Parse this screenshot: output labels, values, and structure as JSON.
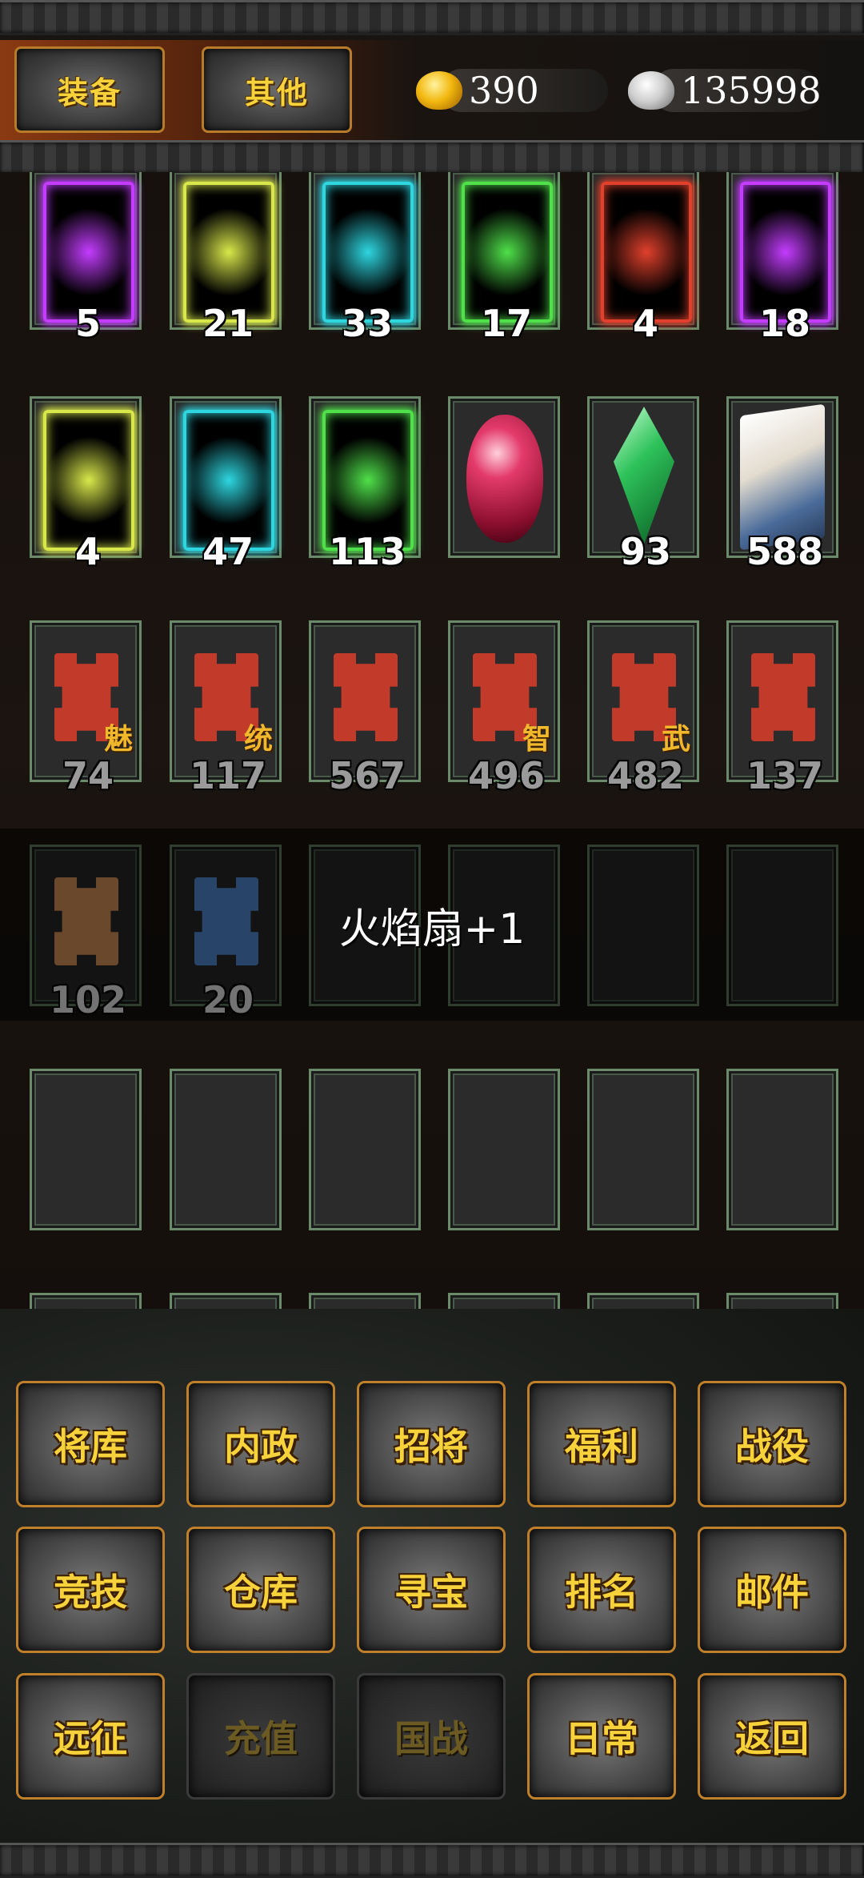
{
  "header": {
    "tabs": [
      {
        "label": "装备"
      },
      {
        "label": "其他"
      }
    ],
    "gold": "390",
    "silver": "135998"
  },
  "inventory": {
    "rows": [
      [
        {
          "count": "5",
          "icon": "horse-card-icon",
          "color": "#c43cff"
        },
        {
          "count": "21",
          "icon": "horse-card-icon",
          "color": "#d8e84a"
        },
        {
          "count": "33",
          "icon": "horse-card-icon",
          "color": "#2ed6e0"
        },
        {
          "count": "17",
          "icon": "horse-card-icon",
          "color": "#4fe04a"
        },
        {
          "count": "4",
          "icon": "seal-card-icon",
          "color": "#e0402c"
        },
        {
          "count": "18",
          "icon": "seal-card-icon",
          "color": "#c43cff"
        }
      ],
      [
        {
          "count": "4",
          "icon": "seal-card-icon",
          "color": "#d8e84a"
        },
        {
          "count": "47",
          "icon": "seal-card-icon",
          "color": "#2ed6e0"
        },
        {
          "count": "113",
          "icon": "seal-card-icon",
          "color": "#4fe04a"
        },
        {
          "count": "",
          "icon": "ruby-gem-icon",
          "color": "#e33a6a"
        },
        {
          "count": "93",
          "icon": "emerald-gem-icon",
          "color": "#2ec25a"
        },
        {
          "count": "588",
          "icon": "book-icon",
          "color": "#4a6b9a"
        }
      ],
      [
        {
          "count": "74",
          "icon": "puzzle-piece-icon",
          "color": "#c23a2a",
          "tag": "魅"
        },
        {
          "count": "117",
          "icon": "puzzle-piece-icon",
          "color": "#c23a2a",
          "tag": "统"
        },
        {
          "count": "567",
          "icon": "puzzle-piece-icon",
          "color": "#c23a2a",
          "tag": ""
        },
        {
          "count": "496",
          "icon": "puzzle-piece-icon",
          "color": "#c23a2a",
          "tag": "智"
        },
        {
          "count": "482",
          "icon": "puzzle-piece-icon",
          "color": "#c23a2a",
          "tag": "武"
        },
        {
          "count": "137",
          "icon": "puzzle-piece-icon",
          "color": "#c23a2a",
          "tag": ""
        }
      ],
      [
        {
          "count": "102",
          "icon": "puzzle-piece-icon",
          "color": "#e8a060",
          "tag": ""
        },
        {
          "count": "20",
          "icon": "puzzle-piece-icon",
          "color": "#5a9ae8",
          "tag": ""
        },
        {
          "count": "",
          "icon": "",
          "color": ""
        },
        {
          "count": "",
          "icon": "",
          "color": ""
        },
        {
          "count": "",
          "icon": "",
          "color": ""
        },
        {
          "count": "",
          "icon": "",
          "color": ""
        }
      ],
      [
        {
          "count": "",
          "icon": "",
          "color": ""
        },
        {
          "count": "",
          "icon": "",
          "color": ""
        },
        {
          "count": "",
          "icon": "",
          "color": ""
        },
        {
          "count": "",
          "icon": "",
          "color": ""
        },
        {
          "count": "",
          "icon": "",
          "color": ""
        },
        {
          "count": "",
          "icon": "",
          "color": ""
        }
      ]
    ]
  },
  "toast": "火焰扇+1",
  "menu": [
    {
      "label": "将库",
      "enabled": true
    },
    {
      "label": "内政",
      "enabled": true
    },
    {
      "label": "招将",
      "enabled": true
    },
    {
      "label": "福利",
      "enabled": true
    },
    {
      "label": "战役",
      "enabled": true
    },
    {
      "label": "竞技",
      "enabled": true
    },
    {
      "label": "仓库",
      "enabled": true
    },
    {
      "label": "寻宝",
      "enabled": true
    },
    {
      "label": "排名",
      "enabled": true
    },
    {
      "label": "邮件",
      "enabled": true
    },
    {
      "label": "远征",
      "enabled": true
    },
    {
      "label": "充值",
      "enabled": false
    },
    {
      "label": "国战",
      "enabled": false
    },
    {
      "label": "日常",
      "enabled": true
    },
    {
      "label": "返回",
      "enabled": true
    }
  ]
}
